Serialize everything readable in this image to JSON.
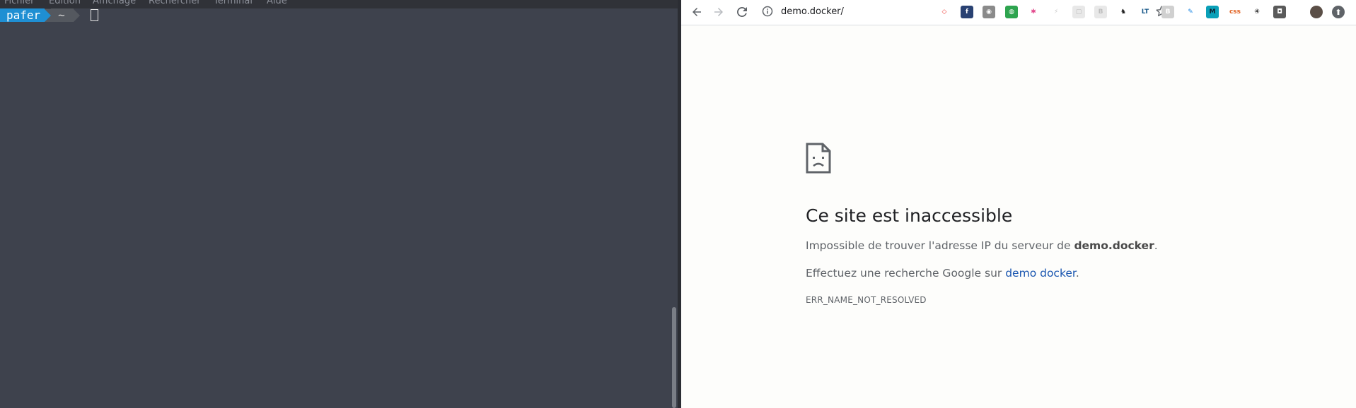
{
  "terminal": {
    "menu": [
      "Fichier",
      "Édition",
      "Affichage",
      "Rechercher",
      "Terminal",
      "Aide"
    ],
    "prompt_user": "pafer",
    "prompt_dir": "~"
  },
  "browser": {
    "url": "demo.docker/",
    "extensions": [
      {
        "name": "ext-1",
        "glyph": "◇",
        "bg": "#ffffff",
        "fg": "#ef3b36"
      },
      {
        "name": "ext-fedora",
        "glyph": "f",
        "bg": "#294172",
        "fg": "#ffffff"
      },
      {
        "name": "ext-3",
        "glyph": "◉",
        "bg": "#8a8a8a",
        "fg": "#ffffff"
      },
      {
        "name": "ext-4",
        "glyph": "◍",
        "bg": "#2ea44f",
        "fg": "#ffffff"
      },
      {
        "name": "ext-5",
        "glyph": "✱",
        "bg": "#ffffff",
        "fg": "#e24a8d"
      },
      {
        "name": "ext-6",
        "glyph": "⚡",
        "bg": "#ffffff",
        "fg": "#c8c8c8"
      },
      {
        "name": "ext-7",
        "glyph": "▢",
        "bg": "#e8e8e8",
        "fg": "#bdbdbd"
      },
      {
        "name": "ext-8",
        "glyph": "B",
        "bg": "#e8e8e8",
        "fg": "#bdbdbd"
      },
      {
        "name": "ext-gnome",
        "glyph": "♞",
        "bg": "#ffffff",
        "fg": "#1c1c1c"
      },
      {
        "name": "ext-lt",
        "glyph": "LT",
        "bg": "#ffffff",
        "fg": "#1a5a8a"
      },
      {
        "name": "ext-b",
        "glyph": "B",
        "bg": "#d0d0d0",
        "fg": "#ffffff"
      },
      {
        "name": "ext-feather",
        "glyph": "✎",
        "bg": "#ffffff",
        "fg": "#1e88e5"
      },
      {
        "name": "ext-m",
        "glyph": "M",
        "bg": "#0aa0b8",
        "fg": "#102030"
      },
      {
        "name": "ext-css",
        "glyph": "css",
        "bg": "#ffffff",
        "fg": "#e06020"
      },
      {
        "name": "ext-ublock",
        "glyph": "④",
        "bg": "#ffffff",
        "fg": "#333333"
      },
      {
        "name": "ext-pocket",
        "glyph": "◘",
        "bg": "#5a5a5a",
        "fg": "#ffffff"
      }
    ]
  },
  "error": {
    "title": "Ce site est inaccessible",
    "line1_prefix": "Impossible de trouver l'adresse IP du serveur de ",
    "line1_host": "demo.docker",
    "line1_suffix": ".",
    "line2_prefix": "Effectuez une recherche Google sur ",
    "line2_link": "demo docker",
    "line2_suffix": ".",
    "code": "ERR_NAME_NOT_RESOLVED"
  }
}
